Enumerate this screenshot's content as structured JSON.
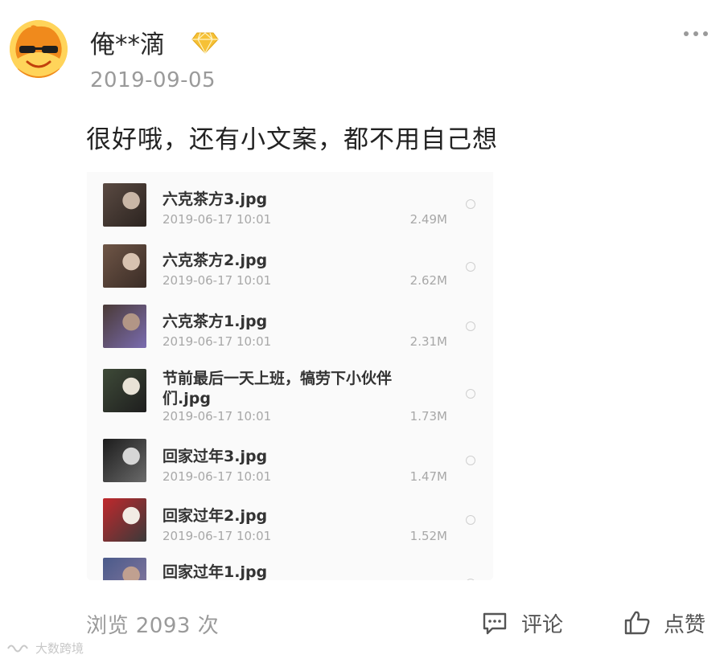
{
  "post": {
    "username": "俺**滴",
    "date": "2019-09-05",
    "comment_text": "很好哦，还有小文案，都不用自己想",
    "avatar_icon": "sunglasses-mascot-avatar",
    "badge_icon": "diamond-vip-icon"
  },
  "file_list": [
    {
      "name": "六克茶方3.jpg",
      "time": "2019-06-17 10:01",
      "size": "2.49M",
      "thumb_colors": [
        "#5a4a42",
        "#c9b6a6",
        "#2c2420"
      ]
    },
    {
      "name": "六克茶方2.jpg",
      "time": "2019-06-17 10:01",
      "size": "2.62M",
      "thumb_colors": [
        "#6e5546",
        "#d8c2b0",
        "#3a2c26"
      ]
    },
    {
      "name": "六克茶方1.jpg",
      "time": "2019-06-17 10:01",
      "size": "2.31M",
      "thumb_colors": [
        "#4a3a36",
        "#b29686",
        "#7a6cb0"
      ]
    },
    {
      "name": "节前最后一天上班，犒劳下小伙伴们.jpg",
      "time": "2019-06-17 10:01",
      "size": "1.73M",
      "thumb_colors": [
        "#3e4a38",
        "#e8e2d6",
        "#1e1e1e"
      ]
    },
    {
      "name": "回家过年3.jpg",
      "time": "2019-06-17 10:01",
      "size": "1.47M",
      "thumb_colors": [
        "#1c1c1c",
        "#d6d6d6",
        "#6a6a6a"
      ]
    },
    {
      "name": "回家过年2.jpg",
      "time": "2019-06-17 10:01",
      "size": "1.52M",
      "thumb_colors": [
        "#c0282c",
        "#f2ece4",
        "#3a3a3a"
      ]
    },
    {
      "name": "回家过年1.jpg",
      "time": "",
      "size": "",
      "thumb_colors": [
        "#4a5a8a",
        "#c0a090",
        "#8a7aa0"
      ]
    }
  ],
  "footer": {
    "views": "浏览 2093 次",
    "comment_label": "评论",
    "like_label": "点赞",
    "watermark": "大数跨境"
  },
  "colors": {
    "background": "#ffffff",
    "secondary_text": "#9a9a9a",
    "avatar_yellow": "#ffd45a",
    "avatar_orange": "#f08a1c",
    "badge_gold": "#f6c136"
  }
}
